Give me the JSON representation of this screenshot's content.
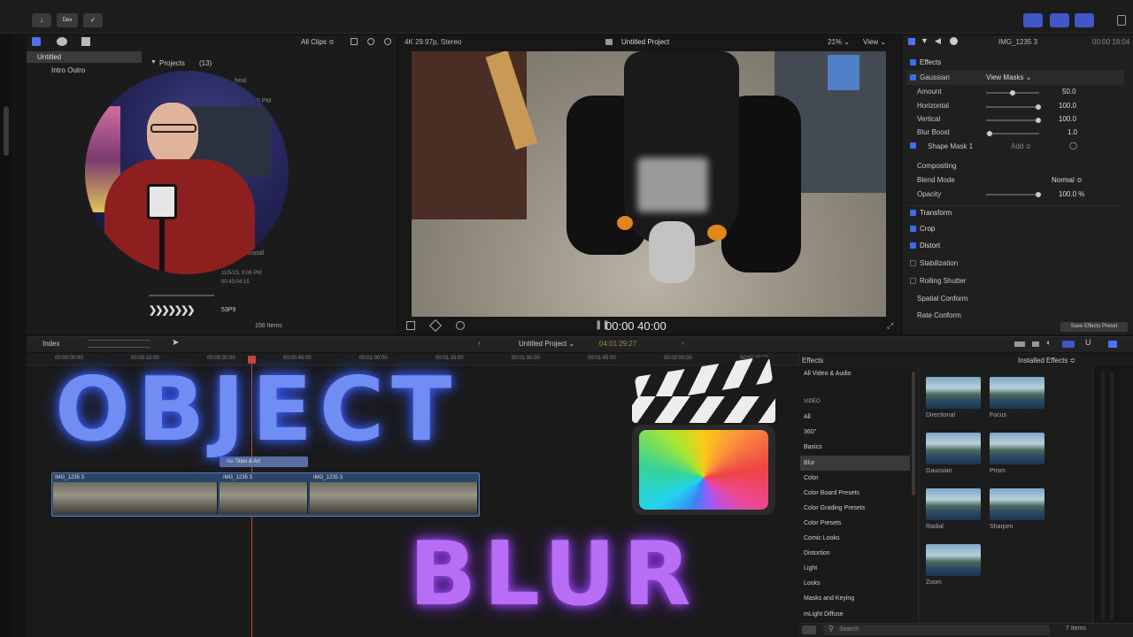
{
  "toolbar": {
    "dev_label": "Dev"
  },
  "browser": {
    "library_name": "Untitled",
    "event_name": "Intro Outro",
    "filter": "All Clips ≎",
    "section": "Projects",
    "section_count": "(13)",
    "item_count": "156 Items",
    "meta_lines": [
      "heal",
      "5 PM",
      "Install",
      "11/5/23, 9:06 PM",
      "00:43:04:15",
      "53P9"
    ]
  },
  "viewer": {
    "format": "4K 29.97p, Stereo",
    "title": "Untitled Project",
    "zoom": "21% ⌄",
    "view": "View ⌄",
    "timecode": "00:00 40:00"
  },
  "inspector": {
    "clip_name": "IMG_1235 3",
    "clip_duration": "00:00 18:04",
    "sections": {
      "effects": "Effects",
      "gaussian": "Gaussian",
      "view_masks": "View Masks ⌄",
      "compositing": "Compositing",
      "transform": "Transform",
      "crop": "Crop",
      "distort": "Distort",
      "stabilization": "Stabilization",
      "rolling_shutter": "Rolling Shutter",
      "spatial_conform": "Spatial Conform",
      "rate_conform": "Rate Conform"
    },
    "params": [
      {
        "label": "Amount",
        "value": "50.0",
        "fill": 0.5
      },
      {
        "label": "Horizontal",
        "value": "100.0",
        "fill": 1.0
      },
      {
        "label": "Vertical",
        "value": "100.0",
        "fill": 1.0
      },
      {
        "label": "Blur Boost",
        "value": "1.0",
        "fill": 0.05
      }
    ],
    "shape_mask": "Shape Mask 1",
    "add": "Add ≎",
    "blend_mode_label": "Blend Mode",
    "blend_mode_value": "Normal ≎",
    "opacity_label": "Opacity",
    "opacity_value": "100.0 %",
    "save_preset": "Save Effects Preset"
  },
  "timeline": {
    "index": "Index",
    "project": "Untitled Project ⌄",
    "position": "04:01:29:27",
    "ruler": [
      "00:00:00:00",
      "00:00:15:00",
      "00:00:30:00",
      "00:00:45:00",
      "00:01:00:00",
      "00:01:15:00",
      "00:01:30:00",
      "00:01:45:00",
      "00:02:00:00",
      "00:02:15:00"
    ],
    "clips": [
      "IMG_1235 3",
      "IMG_1235 3",
      "IMG_1235 3"
    ],
    "connected_clip": "No Titles & Art"
  },
  "effects_browser": {
    "title": "Effects",
    "installed": "Installed Effects ≎",
    "categories": [
      "All Video & Audio",
      "VIDEO",
      "All",
      "360°",
      "Basics",
      "Blur",
      "Color",
      "Color Board Presets",
      "Color Grading Presets",
      "Color Presets",
      "Comic Looks",
      "Distortion",
      "Light",
      "Looks",
      "Masks and Keying",
      "mLight Diffuse"
    ],
    "selected_index": 5,
    "thumbs": [
      "Directional",
      "Focus",
      "Gaussian",
      "Prism",
      "Radial",
      "Sharpen",
      "Zoom"
    ],
    "search_placeholder": "Search",
    "count": "7 Items"
  },
  "overlay": {
    "title_line1": "OBJECT",
    "title_line2": "BLUR",
    "colors": {
      "line1": "#6f8df2",
      "line2": "#b86df5"
    }
  }
}
